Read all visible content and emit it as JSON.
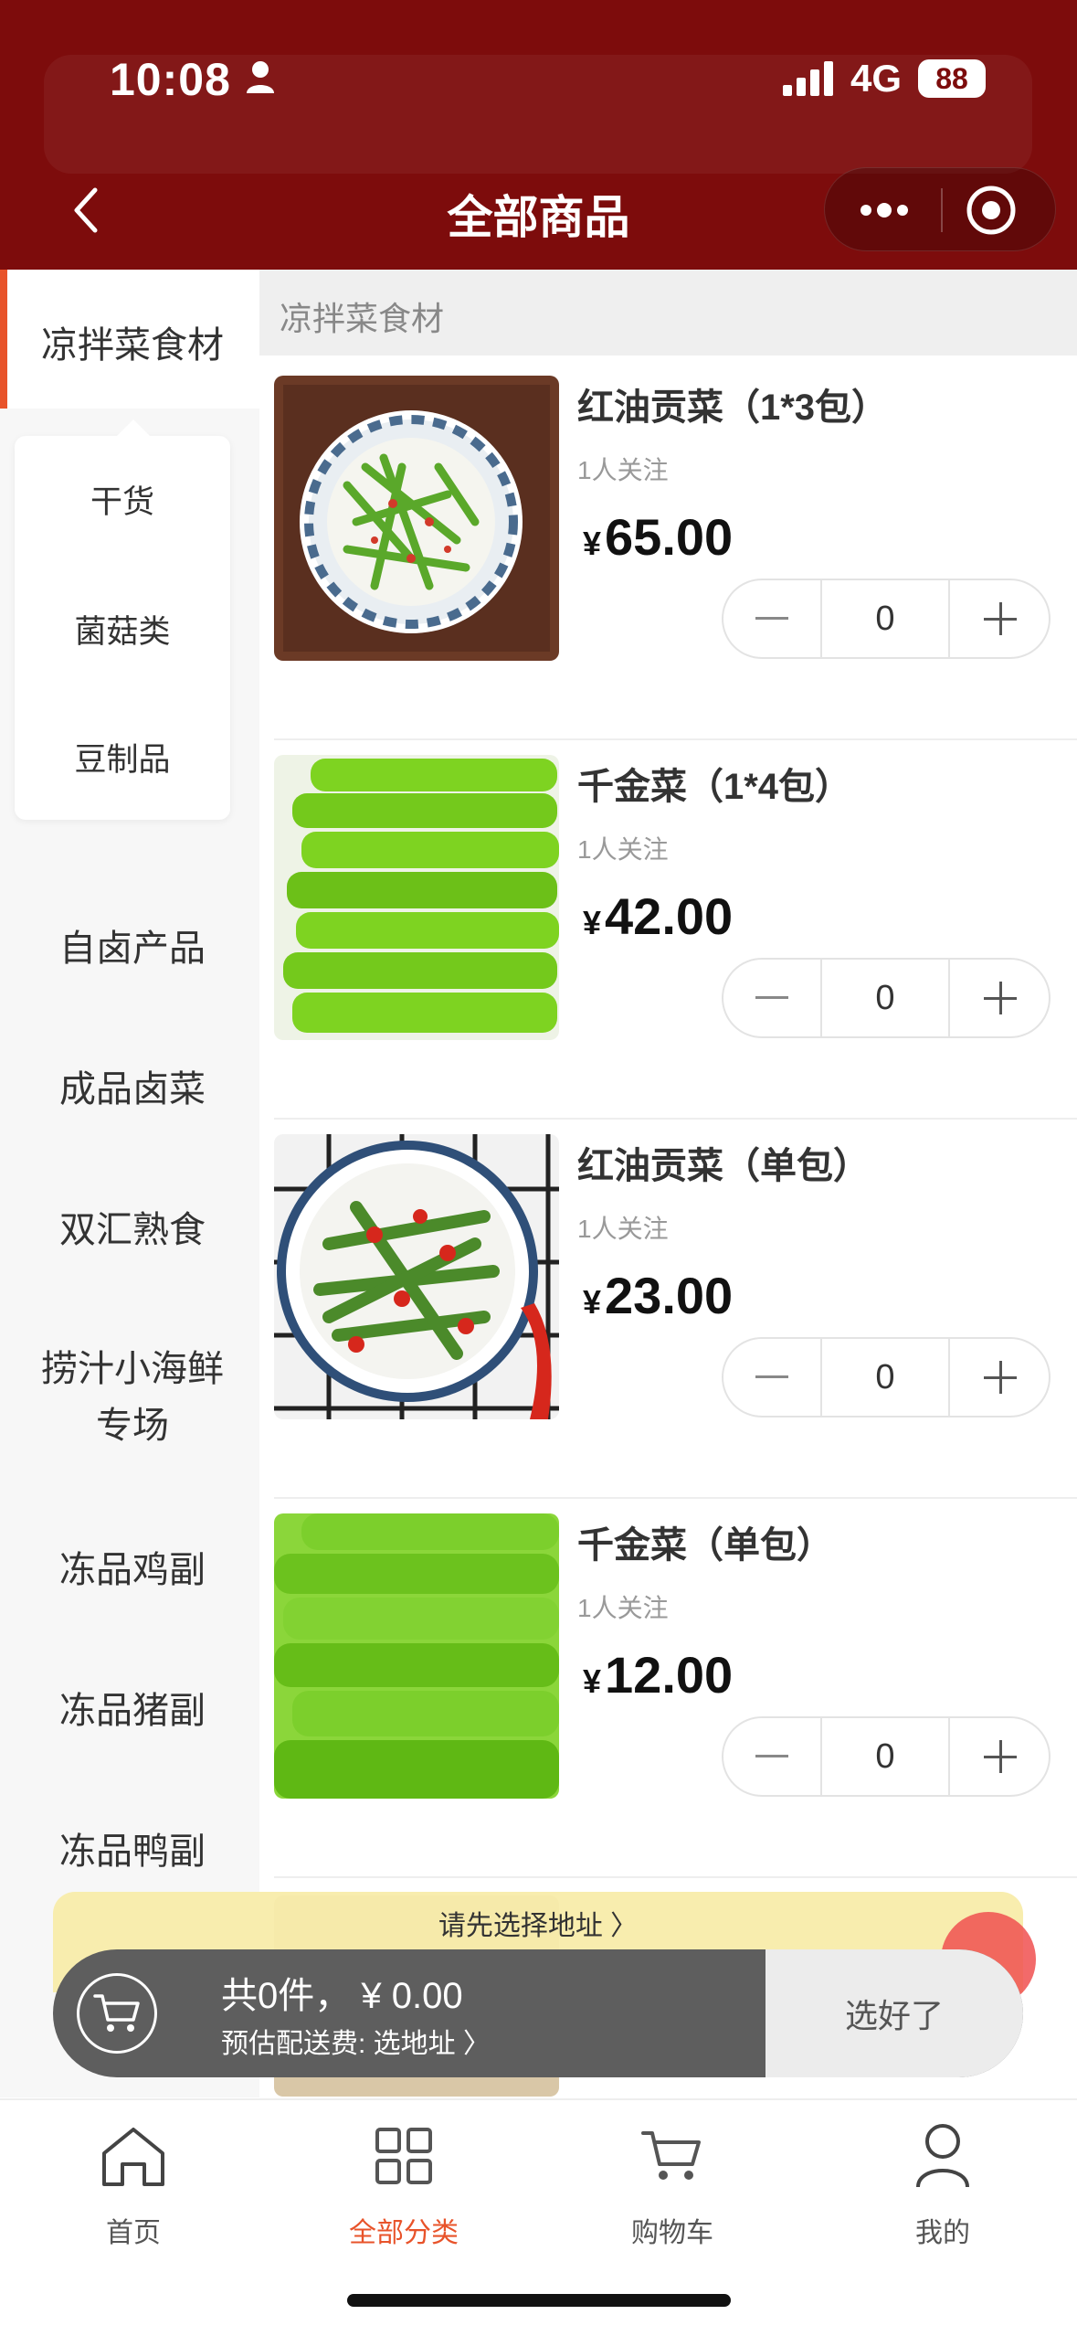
{
  "status": {
    "time": "10:08",
    "network": "4G",
    "battery": "88"
  },
  "nav": {
    "title": "全部商品"
  },
  "sidebar": {
    "active": "凉拌菜食材",
    "subcategories": [
      "干货",
      "菌菇类",
      "豆制品"
    ],
    "items": [
      "自卤产品",
      "成品卤菜",
      "双汇熟食",
      "捞汁小海鲜",
      "专场",
      "冻品鸡副",
      "冻品猪副",
      "冻品鸭副"
    ]
  },
  "content": {
    "category_header": "凉拌菜食材",
    "products": [
      {
        "name": "红油贡菜（1*3包）",
        "follow": "1人关注",
        "currency": "¥",
        "price": "65.00",
        "qty": "0"
      },
      {
        "name": "千金菜（1*4包）",
        "follow": "1人关注",
        "currency": "¥",
        "price": "42.00",
        "qty": "0"
      },
      {
        "name": "红油贡菜（单包）",
        "follow": "1人关注",
        "currency": "¥",
        "price": "23.00",
        "qty": "0"
      },
      {
        "name": "千金菜（单包）",
        "follow": "1人关注",
        "currency": "¥",
        "price": "12.00",
        "qty": "0"
      }
    ]
  },
  "cart": {
    "address_prompt": "请先选择地址 〉",
    "summary": "共0件，  ¥ 0.00",
    "delivery_fee": "预估配送费: 选地址 〉",
    "done_label": "选好了"
  },
  "tabbar": {
    "items": [
      "首页",
      "全部分类",
      "购物车",
      "我的"
    ],
    "active": "全部分类",
    "accent": "#e8532a"
  },
  "colors": {
    "header": "#7d0c0c",
    "accent": "#e8532a"
  }
}
